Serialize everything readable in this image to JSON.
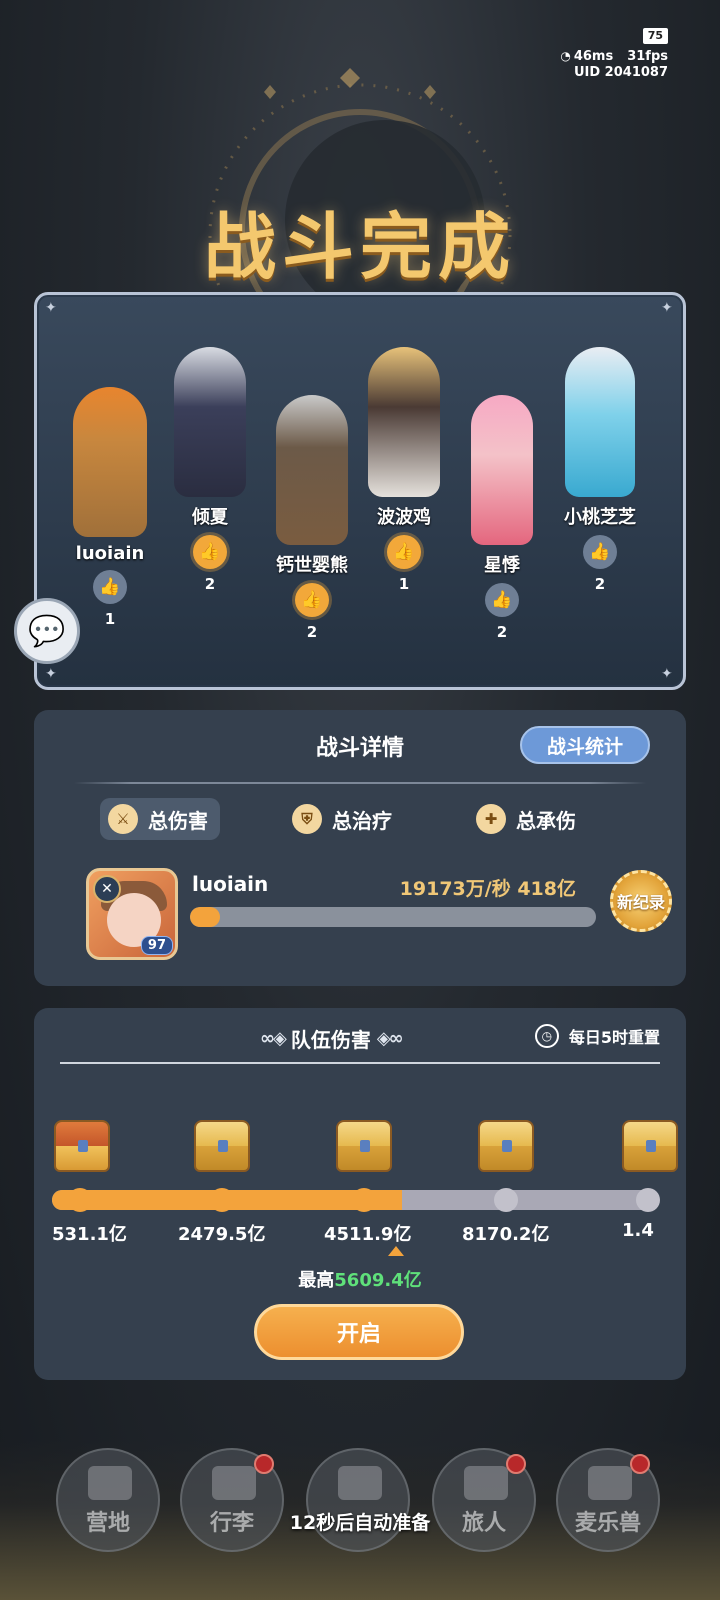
{
  "status": {
    "battery": "75",
    "ping": "46ms",
    "fps": "31fps",
    "uid": "UID 2041087"
  },
  "title": "战斗完成",
  "party": {
    "members": [
      {
        "name": "luoiain",
        "likes": "1",
        "liked": false
      },
      {
        "name": "倾夏",
        "likes": "2",
        "liked": true
      },
      {
        "name": "钙世婴熊",
        "likes": "2",
        "liked": true
      },
      {
        "name": "波波鸡",
        "likes": "1",
        "liked": true
      },
      {
        "name": "星悸",
        "likes": "2",
        "liked": false
      },
      {
        "name": "小桃芝芝",
        "likes": "2",
        "liked": false
      }
    ]
  },
  "detail": {
    "title": "战斗详情",
    "stats_button": "战斗统计",
    "tabs": [
      "总伤害",
      "总治疗",
      "总承伤"
    ],
    "player": {
      "name": "luoiain",
      "level": "97",
      "value": "19173万/秒 418亿",
      "progress": 0.075,
      "badge": "新纪录"
    }
  },
  "team": {
    "title": "队伍伤害",
    "reset": "每日5时重置",
    "milestones": [
      "531.1亿",
      "2479.5亿",
      "4511.9亿",
      "8170.2亿",
      "1.4"
    ],
    "progress_segments_reached": 3,
    "best_label": "最高",
    "best_value": "5609.4亿",
    "open_button": "开启"
  },
  "nav": {
    "items": [
      "营地",
      "行李",
      "",
      "旅人",
      "麦乐兽"
    ],
    "auto_ready": "12秒后自动准备"
  },
  "colors": {
    "accent": "#f3a33c",
    "title": "#f4c86e",
    "best": "#5fe07a",
    "panel": "#35404e"
  }
}
